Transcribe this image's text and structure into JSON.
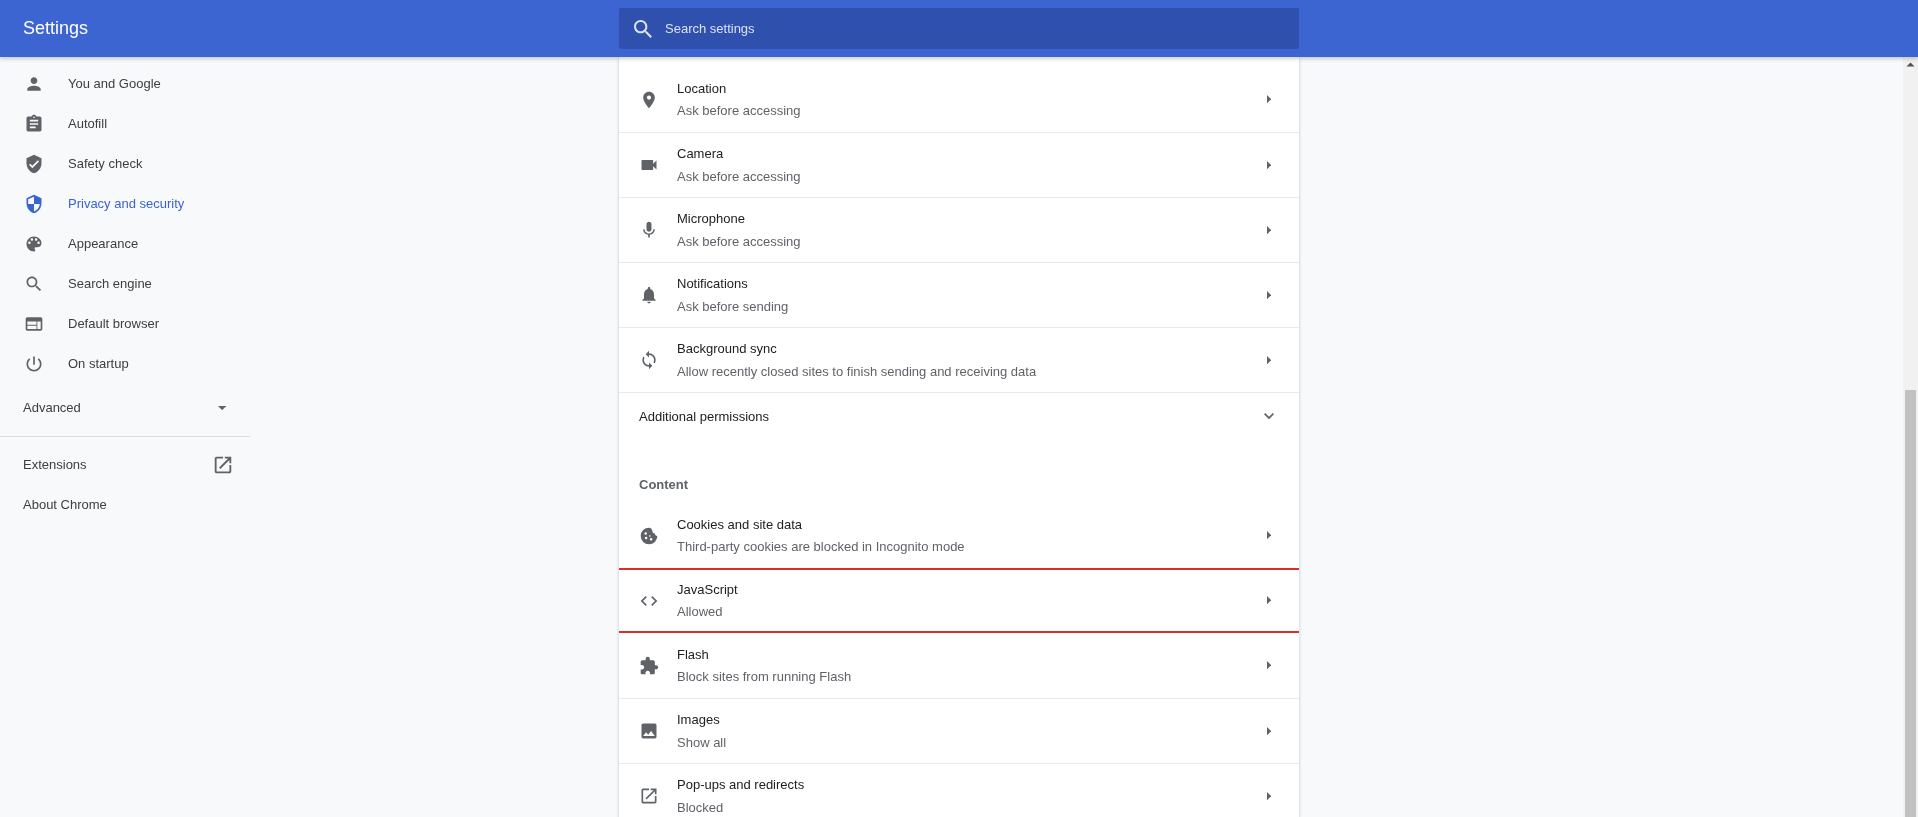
{
  "header": {
    "title": "Settings",
    "search": {
      "placeholder": "Search settings"
    }
  },
  "sidebar": {
    "items": [
      {
        "label": "You and Google",
        "selected": false
      },
      {
        "label": "Autofill",
        "selected": false
      },
      {
        "label": "Safety check",
        "selected": false
      },
      {
        "label": "Privacy and security",
        "selected": true
      },
      {
        "label": "Appearance",
        "selected": false
      },
      {
        "label": "Search engine",
        "selected": false
      },
      {
        "label": "Default browser",
        "selected": false
      },
      {
        "label": "On startup",
        "selected": false
      }
    ],
    "advanced": {
      "label": "Advanced",
      "expanded": false
    },
    "links": [
      "Extensions",
      "About Chrome"
    ]
  },
  "permissions": {
    "rows": [
      {
        "title": "Location",
        "subtitle": "Ask before accessing",
        "highlighted": false
      },
      {
        "title": "Camera",
        "subtitle": "Ask before accessing",
        "highlighted": false
      },
      {
        "title": "Microphone",
        "subtitle": "Ask before accessing",
        "highlighted": false
      },
      {
        "title": "Notifications",
        "subtitle": "Ask before sending",
        "highlighted": false
      },
      {
        "title": "Background sync",
        "subtitle": "Allow recently closed sites to finish sending and receiving data",
        "highlighted": false
      }
    ],
    "additional": {
      "label": "Additional permissions",
      "expanded": false
    }
  },
  "content": {
    "heading": "Content",
    "rows": [
      {
        "title": "Cookies and site data",
        "subtitle": "Third-party cookies are blocked in Incognito mode",
        "highlighted": false
      },
      {
        "title": "JavaScript",
        "subtitle": "Allowed",
        "highlighted": true
      },
      {
        "title": "Flash",
        "subtitle": "Block sites from running Flash",
        "highlighted": false
      },
      {
        "title": "Images",
        "subtitle": "Show all",
        "highlighted": false
      },
      {
        "title": "Pop-ups and redirects",
        "subtitle": "Blocked",
        "highlighted": false
      }
    ]
  }
}
